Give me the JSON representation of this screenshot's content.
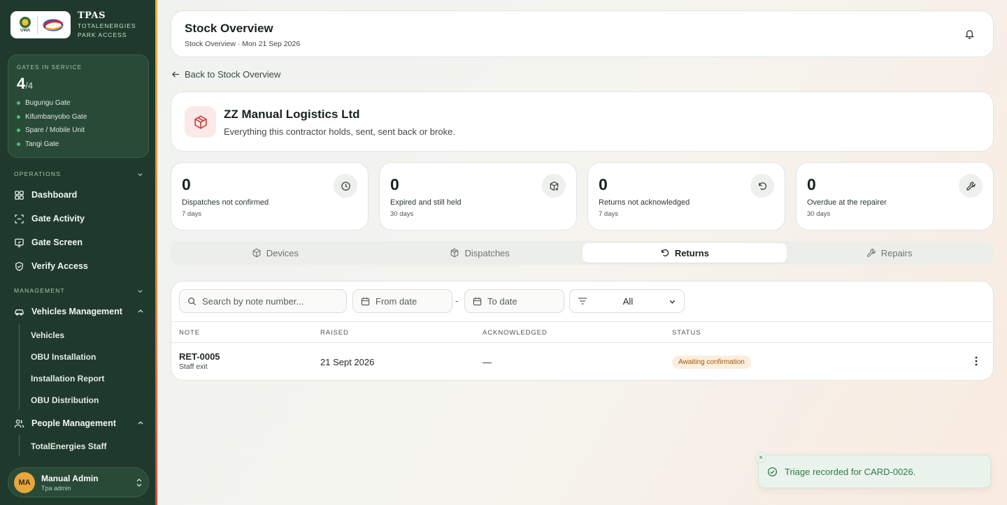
{
  "brand": {
    "title": "TPAS",
    "subtitle_line1": "TOTALENERGIES",
    "subtitle_line2": "PARK ACCESS",
    "uwa_logo_text": "UWA"
  },
  "gates": {
    "title": "GATES IN SERVICE",
    "active": "4",
    "total": "/4",
    "items": [
      "Bugungu Gate",
      "Kifumbanyobo Gate",
      "Spare / Mobile Unit",
      "Tangi Gate"
    ],
    "dot_color": "#4fbf74"
  },
  "sidebar": {
    "operations_label": "OPERATIONS",
    "operations_items": [
      {
        "label": "Dashboard",
        "icon": "grid-icon"
      },
      {
        "label": "Gate Activity",
        "icon": "scan-icon"
      },
      {
        "label": "Gate Screen",
        "icon": "monitor-icon"
      },
      {
        "label": "Verify Access",
        "icon": "shield-check-icon"
      }
    ],
    "management_label": "MANAGEMENT",
    "vehicles_management": "Vehicles Management",
    "vehicles_sub": [
      "Vehicles",
      "OBU Installation",
      "Installation Report",
      "OBU Distribution"
    ],
    "people_management": "People Management",
    "people_sub": [
      "TotalEnergies Staff"
    ]
  },
  "user": {
    "initials": "MA",
    "name": "Manual Admin",
    "role": "Tpa admin"
  },
  "header": {
    "title": "Stock Overview",
    "breadcrumb": "Stock Overview · Mon 21 Sep 2026"
  },
  "back_link": "Back to Stock Overview",
  "contractor": {
    "name": "ZZ Manual Logistics Ltd",
    "description": "Everything this contractor holds, sent, sent back or broke."
  },
  "stats": [
    {
      "value": "0",
      "label": "Dispatches not confirmed",
      "sub": "7 days",
      "icon": "clock-icon"
    },
    {
      "value": "0",
      "label": "Expired and still held",
      "sub": "30 days",
      "icon": "package-x-icon"
    },
    {
      "value": "0",
      "label": "Returns not acknowledged",
      "sub": "7 days",
      "icon": "undo-icon"
    },
    {
      "value": "0",
      "label": "Overdue at the repairer",
      "sub": "30 days",
      "icon": "wrench-icon"
    }
  ],
  "tabs": [
    {
      "label": "Devices",
      "icon": "box-icon",
      "active": false
    },
    {
      "label": "Dispatches",
      "icon": "package-icon",
      "active": false
    },
    {
      "label": "Returns",
      "icon": "undo-icon",
      "active": true
    },
    {
      "label": "Repairs",
      "icon": "wrench-icon",
      "active": false
    }
  ],
  "filters": {
    "search_placeholder": "Search by note number...",
    "from_date": "From date",
    "to_date": "To date",
    "separator": "-",
    "status_value": "All"
  },
  "table": {
    "headers": [
      "NOTE",
      "RAISED",
      "ACKNOWLEDGED",
      "STATUS"
    ],
    "rows": [
      {
        "note": "RET-0005",
        "note_sub": "Staff exit",
        "raised": "21 Sept 2026",
        "acknowledged": "—",
        "status": "Awaiting confirmation"
      }
    ]
  },
  "toast": {
    "message": "Triage recorded for CARD-0026.",
    "close": "×"
  },
  "colors": {
    "sidebar_bg": "#1f3a2c",
    "accent_green": "#2f7a45",
    "badge_bg": "#fbeedd",
    "badge_text": "#a05a12"
  }
}
